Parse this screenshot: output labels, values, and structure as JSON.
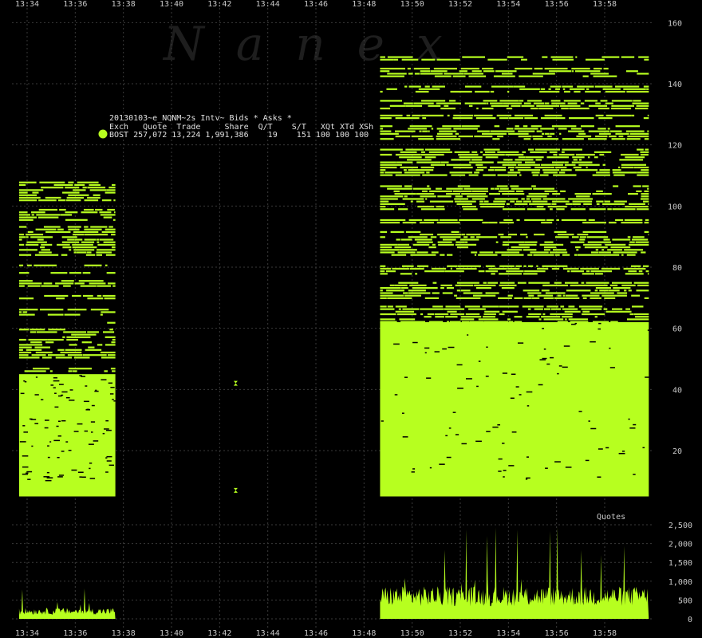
{
  "watermark": "Nanex",
  "legend": {
    "title": "20130103~e_NQNM~2s Intv~ Bids * Asks *",
    "columns": "Exch   Quote  Trade     Share  Q/T    S/T   XQt XTd XSh",
    "row": "BOST 257,072 13,224 1,991,386    19    151 100 100 100"
  },
  "colors": {
    "series": "#b7ff1f",
    "background": "#000000",
    "grid": "#3a3a3a",
    "text": "#c8c8c8"
  },
  "chart_data": [
    {
      "type": "scatter",
      "title": "",
      "series": [
        {
          "name": "Quotes"
        }
      ],
      "x_ticks": [
        "13:34",
        "13:36",
        "13:38",
        "13:40",
        "13:42",
        "13:44",
        "13:46",
        "13:48",
        "13:50",
        "13:52",
        "13:54",
        "13:56",
        "13:58"
      ],
      "y_ticks": [
        20,
        40,
        60,
        80,
        100,
        120,
        140,
        160
      ],
      "ylim": [
        5,
        162
      ],
      "blocks": [
        {
          "x_start": "13:33:40",
          "x_end": "13:37:40",
          "y_min": 5,
          "y_max": 108
        },
        {
          "x_start": "13:48:40",
          "x_end": "13:59:50",
          "y_min": 5,
          "y_max": 149
        }
      ],
      "isolated_points": [
        {
          "x": "13:42:40",
          "y": 42
        },
        {
          "x": "13:42:40",
          "y": 7
        }
      ],
      "grid": true
    },
    {
      "type": "area",
      "title": "",
      "y_ticks": [
        "0",
        "500",
        "1,000",
        "1,500",
        "2,000",
        "2,500"
      ],
      "ylim": [
        0,
        2600
      ],
      "segments": [
        {
          "x_start": "13:33:40",
          "x_end": "13:37:40",
          "typical": 200,
          "peak": 900
        },
        {
          "x_start": "13:48:40",
          "x_end": "13:59:50",
          "typical": 600,
          "peak": 2500
        }
      ],
      "grid": true
    }
  ]
}
